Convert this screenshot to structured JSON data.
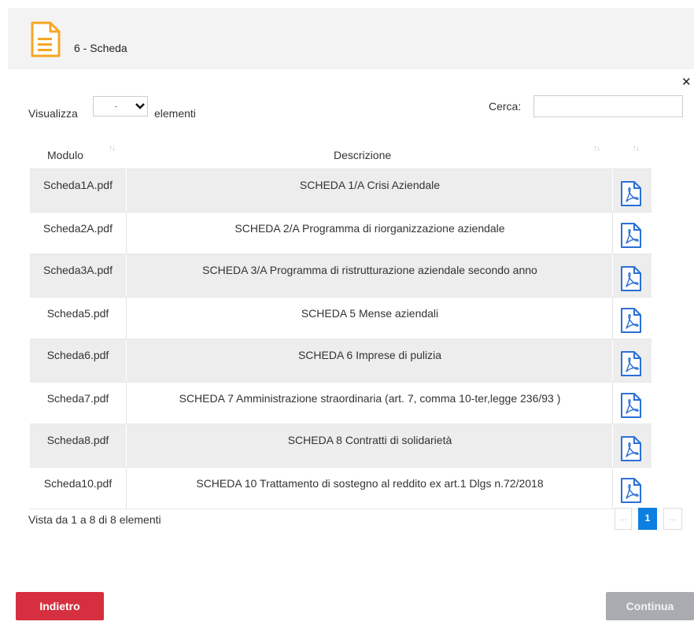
{
  "header": {
    "title": "6 - Scheda",
    "icon": "document-icon",
    "accent": "#f5a623"
  },
  "controls": {
    "length_label": "Visualizza",
    "length_value": "-",
    "length_suffix": "elementi",
    "search_label": "Cerca:",
    "search_value": ""
  },
  "table": {
    "columns": [
      "Modulo",
      "Descrizione",
      ""
    ],
    "rows": [
      {
        "modulo": "Scheda1A.pdf",
        "descrizione": "SCHEDA 1/A Crisi Aziendale"
      },
      {
        "modulo": "Scheda2A.pdf",
        "descrizione": "SCHEDA 2/A Programma di riorganizzazione aziendale"
      },
      {
        "modulo": "Scheda3A.pdf",
        "descrizione": "SCHEDA 3/A Programma di ristrutturazione aziendale secondo anno"
      },
      {
        "modulo": "Scheda5.pdf",
        "descrizione": "SCHEDA 5 Mense aziendali"
      },
      {
        "modulo": "Scheda6.pdf",
        "descrizione": "SCHEDA 6 Imprese di pulizia"
      },
      {
        "modulo": "Scheda7.pdf",
        "descrizione": "SCHEDA 7 Amministrazione straordinaria (art. 7, comma 10-ter,legge 236/93 )"
      },
      {
        "modulo": "Scheda8.pdf",
        "descrizione": "SCHEDA 8 Contratti di solidarietà"
      },
      {
        "modulo": "Scheda10.pdf",
        "descrizione": "SCHEDA 10 Trattamento di sostegno al reddito ex art.1 Dlgs n.72/2018"
      }
    ]
  },
  "footer": {
    "info": "Vista da 1 a 8 di 8 elementi",
    "pagination": {
      "prev": "...",
      "current": "1",
      "next": "..."
    }
  },
  "buttons": {
    "back": "Indietro",
    "continue": "Continua"
  },
  "colors": {
    "primary_red": "#d62f3f",
    "disabled_gray": "#a9abb0",
    "page_active": "#0d7fe0",
    "pdf_blue": "#2b6fd6"
  }
}
